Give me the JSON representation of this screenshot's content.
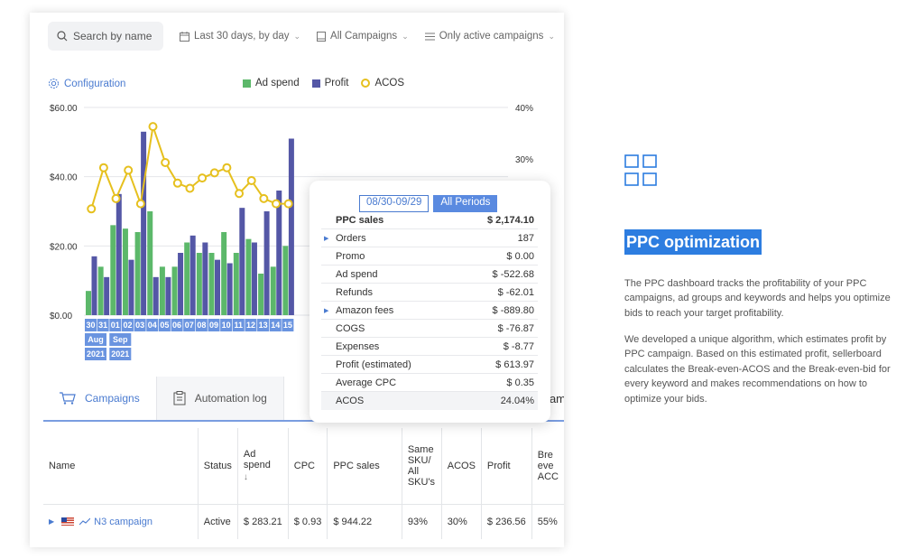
{
  "filters": {
    "search_placeholder": "Search by name",
    "period": "Last 30 days, by day",
    "campaigns": "All Campaigns",
    "active": "Only active campaigns"
  },
  "configuration_label": "Configuration",
  "legend": {
    "ad_spend": "Ad spend",
    "profit": "Profit",
    "acos": "ACOS"
  },
  "colors": {
    "ad_spend": "#5cb86a",
    "profit": "#5457a6",
    "acos": "#e6c01e",
    "accent": "#4a7bd0",
    "title_bg": "#2d7de0"
  },
  "chart_data": {
    "type": "bar",
    "left_axis": {
      "ticks": [
        "$60.00",
        "$40.00",
        "$20.00",
        "$0.00"
      ],
      "ylim": [
        0,
        60
      ]
    },
    "right_axis": {
      "ticks": [
        "40%",
        "30%"
      ]
    },
    "categories": [
      "30",
      "31",
      "01",
      "02",
      "03",
      "04",
      "05",
      "06",
      "07",
      "08",
      "09",
      "10",
      "11",
      "12",
      "13",
      "14",
      "15"
    ],
    "month_labels": [
      {
        "month": "Aug",
        "year": "2021"
      },
      {
        "month": "Sep",
        "year": "2021"
      }
    ],
    "series": [
      {
        "name": "Ad spend",
        "type": "bar",
        "values": [
          7,
          14,
          26,
          25,
          24,
          30,
          14,
          14,
          21,
          18,
          18,
          24,
          18,
          22,
          12,
          14,
          20
        ]
      },
      {
        "name": "Profit",
        "type": "bar",
        "values": [
          17,
          11,
          35,
          16,
          53,
          11,
          11,
          18,
          23,
          21,
          16,
          15,
          31,
          21,
          30,
          36,
          51
        ]
      },
      {
        "name": "ACOS",
        "type": "line",
        "unit": "%",
        "values": [
          21,
          29,
          23,
          28.5,
          22,
          37,
          30,
          26,
          25,
          27,
          28,
          29,
          24,
          26.5,
          23,
          22,
          22
        ]
      }
    ]
  },
  "tabs": {
    "campaigns": "Campaigns",
    "automation": "Automation log",
    "cut": "am"
  },
  "table": {
    "headers": [
      "Name",
      "Status",
      "Ad spend",
      "CPC",
      "PPC sales",
      "Same SKU/ All SKU's",
      "ACOS",
      "Profit",
      "Bre eve ACC"
    ],
    "row": {
      "name": "N3 campaign",
      "status": "Active",
      "ad_spend": "$ 283.21",
      "cpc": "$ 0.93",
      "ppc_sales": "$ 944.22",
      "same_sku": "93%",
      "acos": "30%",
      "profit": "$ 236.56",
      "breakeven": "55%"
    }
  },
  "popup": {
    "period_button": "08/30-09/29",
    "all_periods_button": "All Periods",
    "rows": [
      {
        "label": "PPC sales",
        "value": "$ 2,174.10",
        "bold": true,
        "expand": false
      },
      {
        "label": "Orders",
        "value": "187",
        "bold": false,
        "expand": true
      },
      {
        "label": "Promo",
        "value": "$ 0.00",
        "bold": false,
        "expand": false
      },
      {
        "label": "Ad spend",
        "value": "$ -522.68",
        "bold": false,
        "expand": false
      },
      {
        "label": "Refunds",
        "value": "$ -62.01",
        "bold": false,
        "expand": false
      },
      {
        "label": "Amazon fees",
        "value": "$ -889.80",
        "bold": false,
        "expand": true
      },
      {
        "label": "COGS",
        "value": "$ -76.87",
        "bold": false,
        "expand": false
      },
      {
        "label": "Expenses",
        "value": "$ -8.77",
        "bold": false,
        "expand": false
      },
      {
        "label": "Profit (estimated)",
        "value": "$ 613.97",
        "bold": false,
        "expand": false
      },
      {
        "label": "Average CPC",
        "value": "$ 0.35",
        "bold": false,
        "expand": false
      },
      {
        "label": "ACOS",
        "value": "24.04%",
        "bold": false,
        "expand": false
      }
    ]
  },
  "feature": {
    "title": "PPC optimization",
    "paragraph1": "The PPC dashboard tracks the profitability of your PPC campaigns, ad groups and keywords and helps you optimize bids to reach your target profitability.",
    "paragraph2": "We developed a unique algorithm, which estimates profit by PPC campaign. Based on this estimated profit, sellerboard calculates the Break-even-ACOS and the Break-even-bid for every keyword and makes recommendations on how to optimize your bids."
  }
}
